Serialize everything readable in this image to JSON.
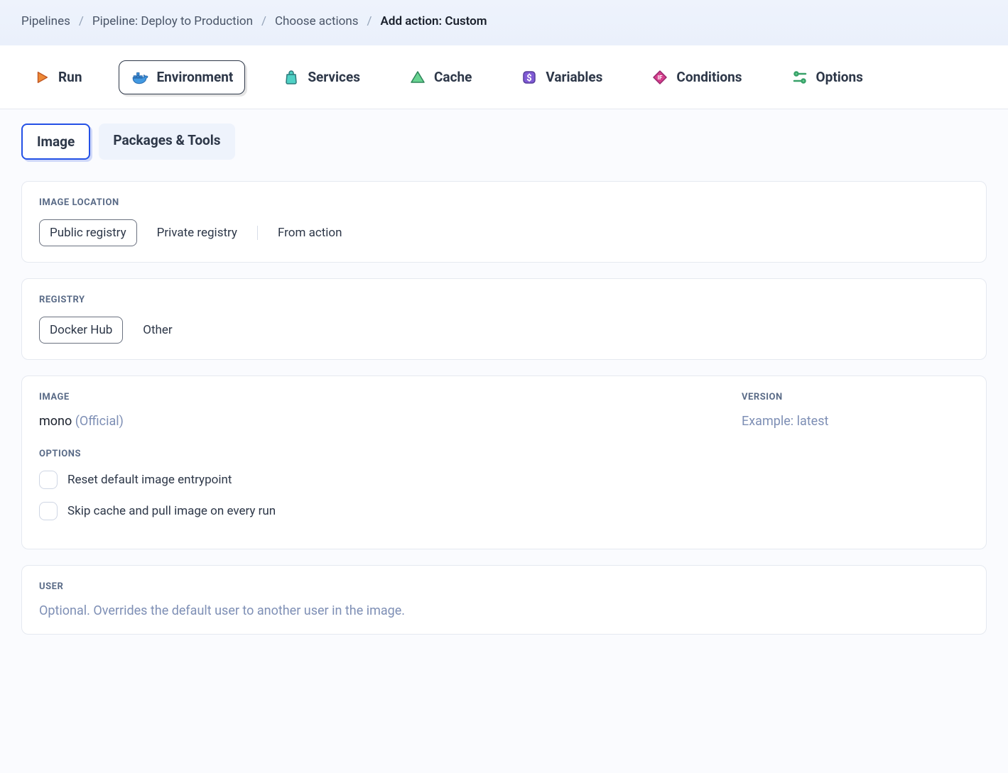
{
  "breadcrumb": {
    "items": [
      {
        "label": "Pipelines"
      },
      {
        "label": "Pipeline: Deploy to Production"
      },
      {
        "label": "Choose actions"
      }
    ],
    "current": "Add action: Custom"
  },
  "mainTabs": [
    {
      "id": "run",
      "label": "Run",
      "icon": "play",
      "active": false
    },
    {
      "id": "environment",
      "label": "Environment",
      "icon": "docker",
      "active": true
    },
    {
      "id": "services",
      "label": "Services",
      "icon": "bag",
      "active": false
    },
    {
      "id": "cache",
      "label": "Cache",
      "icon": "triangle",
      "active": false
    },
    {
      "id": "variables",
      "label": "Variables",
      "icon": "dollar",
      "active": false
    },
    {
      "id": "conditions",
      "label": "Conditions",
      "icon": "diamond",
      "active": false
    },
    {
      "id": "options",
      "label": "Options",
      "icon": "sliders",
      "active": false
    }
  ],
  "subTabs": [
    {
      "id": "image",
      "label": "Image",
      "active": true
    },
    {
      "id": "packages",
      "label": "Packages & Tools",
      "active": false
    }
  ],
  "imageLocation": {
    "label": "Image Location",
    "options": [
      {
        "label": "Public registry",
        "selected": true
      },
      {
        "label": "Private registry",
        "selected": false
      },
      {
        "label": "From action",
        "selected": false
      }
    ]
  },
  "registry": {
    "label": "Registry",
    "options": [
      {
        "label": "Docker Hub",
        "selected": true
      },
      {
        "label": "Other",
        "selected": false
      }
    ]
  },
  "image": {
    "label": "Image",
    "value": "mono",
    "badge": "(Official)"
  },
  "version": {
    "label": "Version",
    "placeholder": "Example: latest",
    "value": ""
  },
  "options": {
    "label": "Options",
    "items": [
      {
        "label": "Reset default image entrypoint",
        "checked": false
      },
      {
        "label": "Skip cache and pull image on every run",
        "checked": false
      }
    ]
  },
  "user": {
    "label": "User",
    "placeholder": "Optional. Overrides the default user to another user in the image.",
    "value": ""
  }
}
